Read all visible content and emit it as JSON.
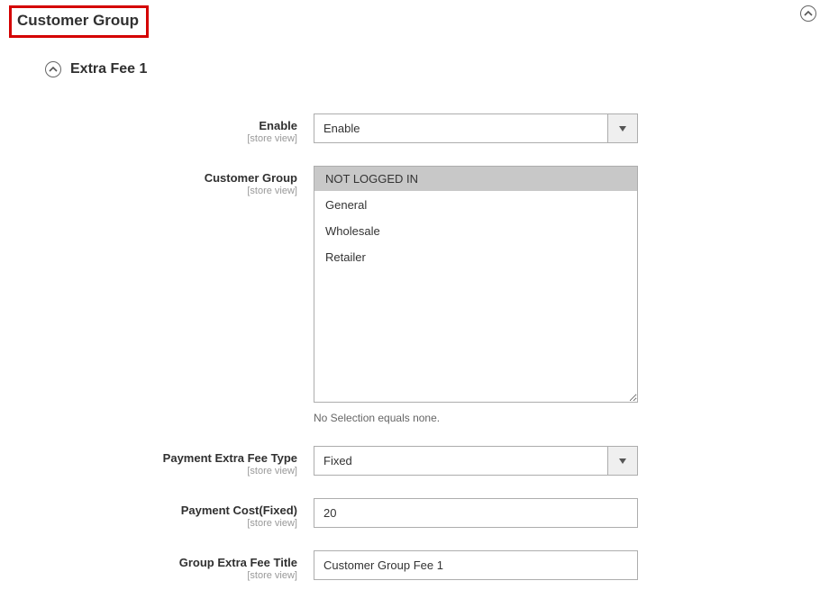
{
  "section": {
    "title": "Customer Group"
  },
  "subsection": {
    "title": "Extra Fee 1"
  },
  "scope_label": "[store view]",
  "fields": {
    "enable": {
      "label": "Enable",
      "value": "Enable"
    },
    "customer_group": {
      "label": "Customer Group",
      "options": [
        "NOT LOGGED IN",
        "General",
        "Wholesale",
        "Retailer"
      ],
      "selected_index": 0,
      "helper": "No Selection equals none."
    },
    "fee_type": {
      "label": "Payment Extra Fee Type",
      "value": "Fixed"
    },
    "payment_cost": {
      "label": "Payment Cost(Fixed)",
      "value": "20"
    },
    "fee_title": {
      "label": "Group Extra Fee Title",
      "value": "Customer Group Fee 1"
    }
  }
}
